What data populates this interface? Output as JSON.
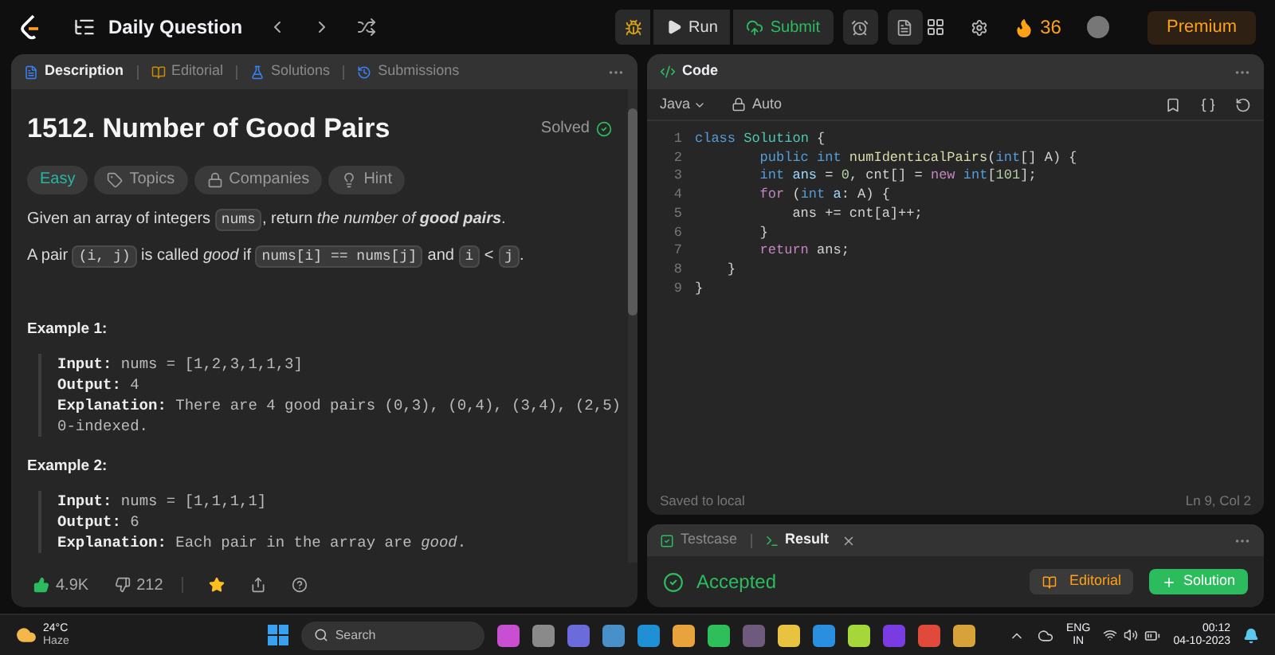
{
  "nav": {
    "title": "Daily Question",
    "run": "Run",
    "submit": "Submit",
    "streak": "36",
    "premium": "Premium"
  },
  "left_tabs": [
    {
      "label": "Description",
      "selected": true
    },
    {
      "label": "Editorial",
      "selected": false
    },
    {
      "label": "Solutions",
      "selected": false
    },
    {
      "label": "Submissions",
      "selected": false
    }
  ],
  "problem": {
    "title": "1512. Number of Good Pairs",
    "status": "Solved",
    "tags": [
      {
        "kind": "difficulty",
        "label": "Easy"
      },
      {
        "kind": "topics",
        "label": "Topics"
      },
      {
        "kind": "companies",
        "label": "Companies"
      },
      {
        "kind": "hint",
        "label": "Hint"
      }
    ],
    "paragraphs": [
      [
        {
          "kind": "text",
          "text": "Given an array of integers "
        },
        {
          "kind": "code",
          "text": "nums"
        },
        {
          "kind": "text",
          "text": ", return "
        },
        {
          "kind": "italic",
          "text": "the number of "
        },
        {
          "kind": "bold_italic",
          "text": "good pairs"
        },
        {
          "kind": "text",
          "text": "."
        }
      ],
      [
        {
          "kind": "text",
          "text": "A pair "
        },
        {
          "kind": "code",
          "text": "(i, j)"
        },
        {
          "kind": "text",
          "text": " is called "
        },
        {
          "kind": "italic",
          "text": "good"
        },
        {
          "kind": "text",
          "text": " if "
        },
        {
          "kind": "code",
          "text": "nums[i] == nums[j]"
        },
        {
          "kind": "text",
          "text": " and "
        },
        {
          "kind": "code",
          "text": "i"
        },
        {
          "kind": "text",
          "text": " < "
        },
        {
          "kind": "code",
          "text": "j"
        },
        {
          "kind": "text",
          "text": "."
        }
      ]
    ],
    "examples": [
      {
        "heading": "Example 1:",
        "lines": [
          {
            "label": "Input:",
            "value": "nums = [1,2,3,1,1,3]"
          },
          {
            "label": "Output:",
            "value": "4"
          },
          {
            "label": "Explanation:",
            "value": "There are 4 good pairs (0,3), (0,4), (3,4), (2,5)"
          }
        ],
        "continuation": "0-indexed."
      },
      {
        "heading": "Example 2:",
        "lines": [
          {
            "label": "Input:",
            "value": "nums = [1,1,1,1]"
          },
          {
            "label": "Output:",
            "value": "6"
          },
          {
            "label": "Explanation:",
            "value": "Each pair in the array are *good*."
          }
        ]
      }
    ]
  },
  "footer": {
    "likes": "4.9K",
    "dislikes": "212",
    "starred": true
  },
  "code_panel": {
    "title": "Code",
    "language": "Java",
    "mode": "Auto",
    "lines": [
      {
        "number": "1",
        "tokens": [
          {
            "kind": "kw",
            "text": "class "
          },
          {
            "kind": "type",
            "text": "Solution"
          },
          {
            "kind": "plain",
            "text": " {"
          }
        ]
      },
      {
        "number": "2",
        "tokens": [
          {
            "kind": "kw",
            "text": "        public int "
          },
          {
            "kind": "fn",
            "text": "numIdenticalPairs"
          },
          {
            "kind": "plain",
            "text": "("
          },
          {
            "kind": "kw",
            "text": "int"
          },
          {
            "kind": "plain",
            "text": "[] A) {"
          }
        ]
      },
      {
        "number": "3",
        "tokens": [
          {
            "kind": "kw",
            "text": "        int "
          },
          {
            "kind": "var",
            "text": "ans"
          },
          {
            "kind": "plain",
            "text": " = "
          },
          {
            "kind": "num",
            "text": "0"
          },
          {
            "kind": "plain",
            "text": ", cnt[] = "
          },
          {
            "kind": "ctrl",
            "text": "new "
          },
          {
            "kind": "kw",
            "text": "int"
          },
          {
            "kind": "plain",
            "text": "["
          },
          {
            "kind": "num",
            "text": "101"
          },
          {
            "kind": "plain",
            "text": "];"
          }
        ]
      },
      {
        "number": "4",
        "tokens": [
          {
            "kind": "ctrl",
            "text": "        for"
          },
          {
            "kind": "plain",
            "text": " ("
          },
          {
            "kind": "kw",
            "text": "int "
          },
          {
            "kind": "var",
            "text": "a"
          },
          {
            "kind": "plain",
            "text": ": A) {"
          }
        ]
      },
      {
        "number": "5",
        "tokens": [
          {
            "kind": "plain",
            "text": "            ans += cnt[a]++;"
          }
        ]
      },
      {
        "number": "6",
        "tokens": [
          {
            "kind": "plain",
            "text": "        }"
          }
        ]
      },
      {
        "number": "7",
        "tokens": [
          {
            "kind": "ctrl",
            "text": "        return"
          },
          {
            "kind": "plain",
            "text": " ans;"
          }
        ]
      },
      {
        "number": "8",
        "tokens": [
          {
            "kind": "plain",
            "text": "    }"
          }
        ]
      },
      {
        "number": "9",
        "tokens": [
          {
            "kind": "plain",
            "text": "}"
          }
        ]
      }
    ],
    "saved": "Saved to local",
    "cursor": "Ln 9, Col 2"
  },
  "result_tabs": [
    {
      "label": "Testcase",
      "selected": false
    },
    {
      "label": "Result",
      "selected": true
    }
  ],
  "result": {
    "verdict": "Accepted",
    "editorial": "Editorial",
    "solution": "Solution"
  },
  "taskbar": {
    "temperature": "24°C",
    "weather": "Haze",
    "search": "Search",
    "language": "ENG",
    "region": "IN",
    "time": "00:12",
    "date": "04-10-2023"
  }
}
